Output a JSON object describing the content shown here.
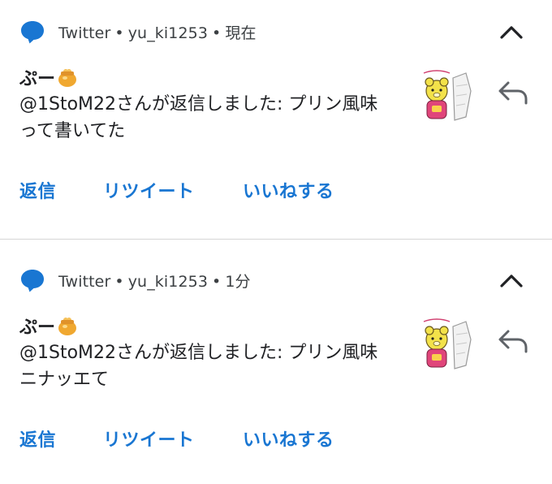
{
  "notifications": [
    {
      "app": "Twitter",
      "account": "yu_ki1253",
      "time": "現在",
      "sender": "ぷー",
      "sender_emoji_icon": "honey-pot-icon",
      "message": "@1StoM22さんが返信しました: プリン風味って書いてた",
      "actions": [
        "返信",
        "リツイート",
        "いいねする"
      ]
    },
    {
      "app": "Twitter",
      "account": "yu_ki1253",
      "time": "1分",
      "sender": "ぷー",
      "sender_emoji_icon": "honey-pot-icon",
      "message": "@1StoM22さんが返信しました: プリン風味ニナッエて",
      "actions": [
        "返信",
        "リツイート",
        "いいねする"
      ]
    }
  ],
  "separator": "•",
  "colors": {
    "app_icon": "#1976d2",
    "action_text": "#1976d2",
    "header_text": "#3c4043",
    "body_text": "#202124",
    "divider": "#d5d5d5"
  }
}
